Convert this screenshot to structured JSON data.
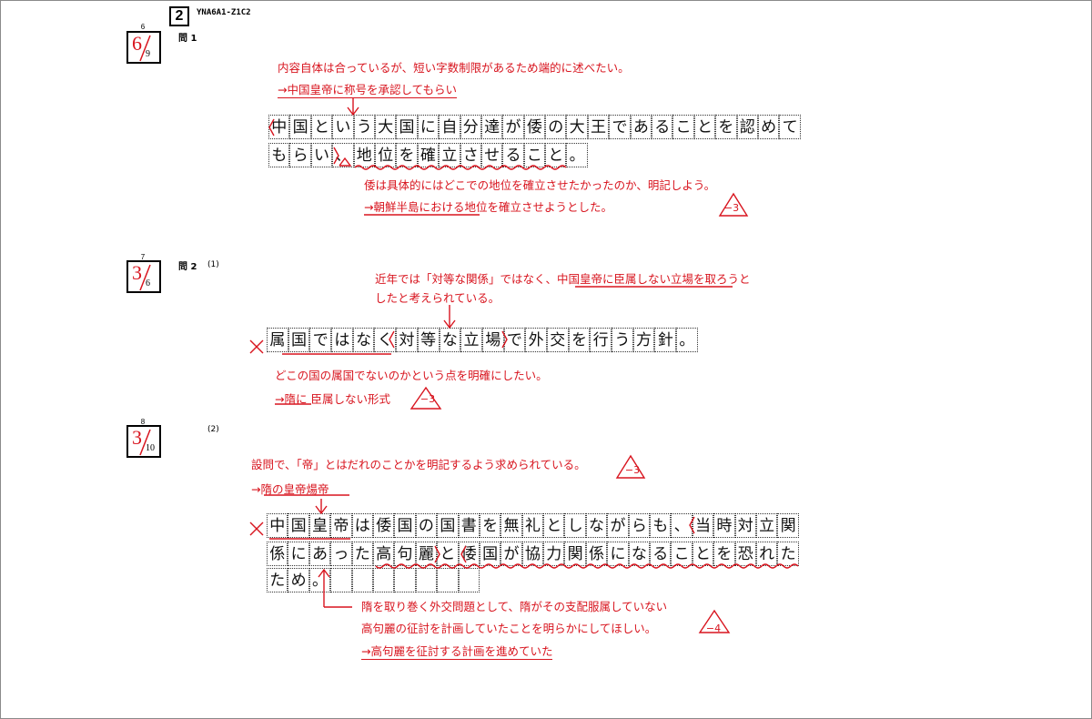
{
  "header": {
    "question_number": "2",
    "code": "YNA6A1-Z1C2"
  },
  "q1": {
    "score_no": "6",
    "score": "6",
    "score_total": "9",
    "label": "問 1",
    "comment_top_1": "内容自体は合っているが、短い字数制限があるため端的に述べたい。",
    "comment_top_2": "→中国皇帝に称号を承認してもらい",
    "answer_row1": [
      "中",
      "国",
      "と",
      "い",
      "う",
      "大",
      "国",
      "に",
      "自",
      "分",
      "達",
      "が",
      "倭",
      "の",
      "大",
      "王",
      "で",
      "あ",
      "る",
      "こ",
      "と",
      "を",
      "認",
      "め",
      "て"
    ],
    "answer_row2": [
      "も",
      "ら",
      "い",
      "、",
      "地",
      "位",
      "を",
      "確",
      "立",
      "さ",
      "せ",
      "る",
      "こ",
      "と",
      "。"
    ],
    "comment_bottom_1": "倭は具体的にはどこでの地位を確立させたかったのか、明記しよう。",
    "comment_bottom_2": "→朝鮮半島における地位を確立させようとした。",
    "penalty": "−3"
  },
  "q2_1": {
    "score_no": "7",
    "score": "3",
    "score_total": "6",
    "label": "問 2",
    "sub": "(1)",
    "comment_top_1": "近年では「対等な関係」ではなく、中国皇帝に臣属しない立場を取ろうと",
    "comment_top_2": "したと考えられている。",
    "answer_row": [
      "属",
      "国",
      "で",
      "は",
      "な",
      "く",
      "対",
      "等",
      "な",
      "立",
      "場",
      "で",
      "外",
      "交",
      "を",
      "行",
      "う",
      "方",
      "針",
      "。"
    ],
    "comment_bottom_1": "どこの国の属国でないのかという点を明確にしたい。",
    "comment_bottom_2": "→隋に 臣属しない形式",
    "penalty": "−3"
  },
  "q2_2": {
    "score_no": "8",
    "score": "3",
    "score_total": "10",
    "sub": "(2)",
    "comment_top_1": "設問で、「帝」とはだれのことかを明記するよう求められている。",
    "comment_top_2": "→隋の皇帝煬帝",
    "penalty_top": "−3",
    "answer_row1": [
      "中",
      "国",
      "皇",
      "帝",
      "は",
      "倭",
      "国",
      "の",
      "国",
      "書",
      "を",
      "無",
      "礼",
      "と",
      "し",
      "な",
      "が",
      "ら",
      "も",
      "、",
      "当",
      "時",
      "対",
      "立",
      "関"
    ],
    "answer_row2": [
      "係",
      "に",
      "あ",
      "っ",
      "た",
      "高",
      "句",
      "麗",
      "と",
      "倭",
      "国",
      "が",
      "協",
      "力",
      "関",
      "係",
      "に",
      "な",
      "る",
      "こ",
      "と",
      "を",
      "恐",
      "れ",
      "た"
    ],
    "answer_row3": [
      "た",
      "め",
      "。",
      "",
      "",
      "",
      "",
      "",
      "",
      ""
    ],
    "comment_bottom_1": "隋を取り巻く外交問題として、隋がその支配服属していない",
    "comment_bottom_2": "高句麗の征討を計画していたことを明らかにしてほしい。",
    "comment_bottom_3": "→高句麗を征討する計画を進めていた",
    "penalty_bottom": "−4"
  },
  "colors": {
    "accent": "#d8141e",
    "ink": "#000000"
  }
}
